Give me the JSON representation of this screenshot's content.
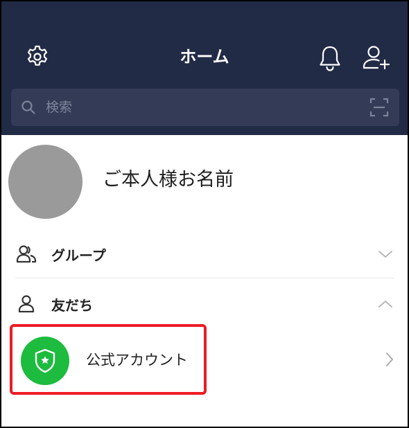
{
  "header": {
    "title": "ホーム",
    "background_color": "#222b45",
    "icons": [
      "gear-icon",
      "bell-icon",
      "add-friend-icon"
    ]
  },
  "search": {
    "placeholder": "検索",
    "icon": "search-icon",
    "scan_icon": "qr-scan-icon"
  },
  "profile": {
    "name": "ご本人様お名前"
  },
  "sections": {
    "groups": {
      "label": "グループ",
      "icon": "groups-icon",
      "state": "collapsed"
    },
    "friends": {
      "label": "友だち",
      "icon": "friend-icon",
      "state": "expanded"
    }
  },
  "official_account": {
    "label": "公式アカウント",
    "icon": "shield-star-icon",
    "icon_color": "#1dbb3e",
    "highlight_color": "#ee1b24"
  }
}
